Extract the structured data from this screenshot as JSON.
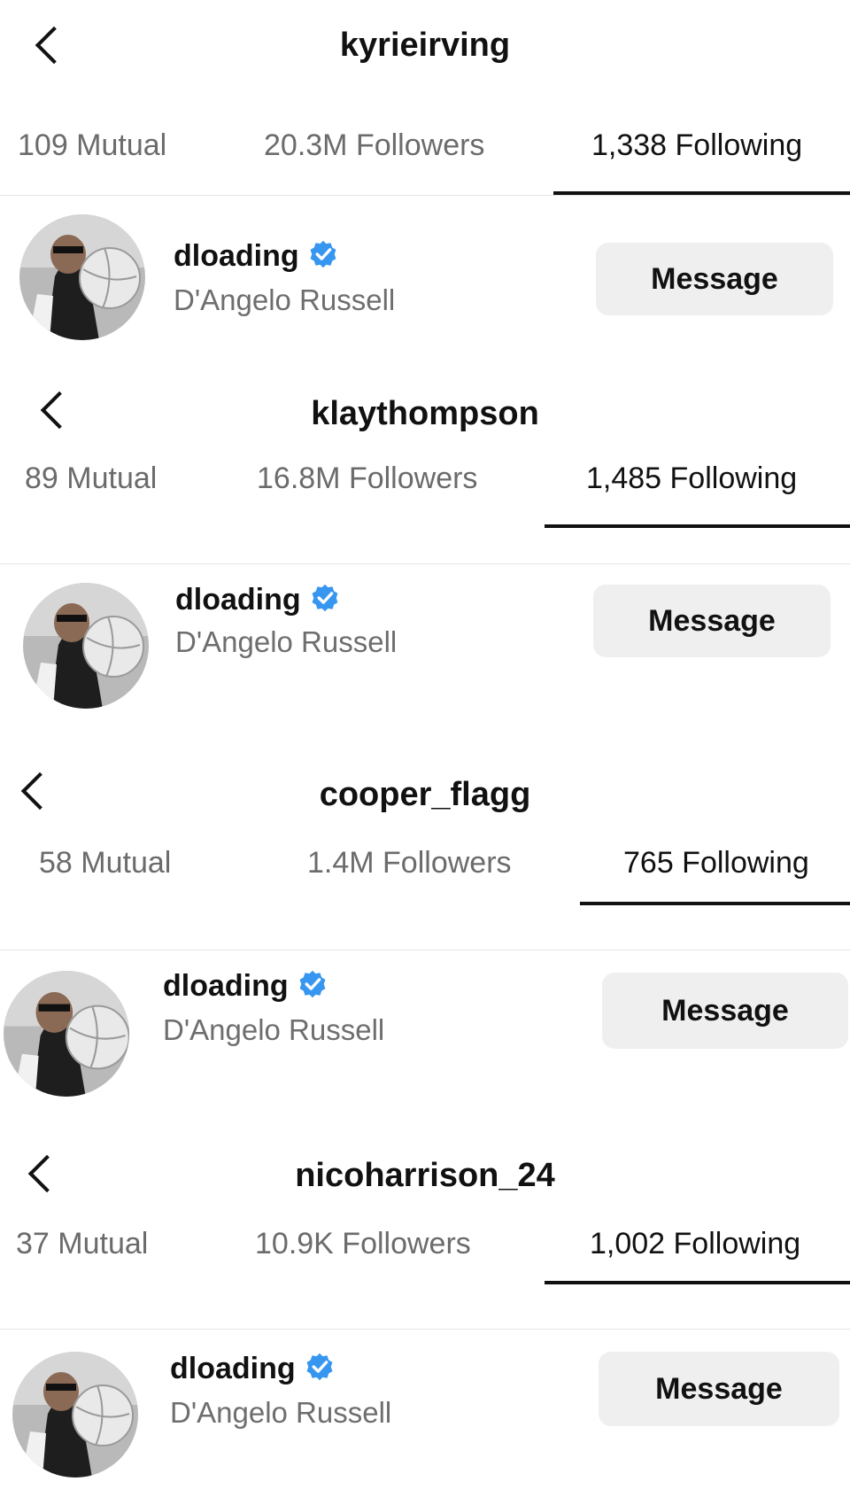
{
  "panels": [
    {
      "profile_username": "kyrieirving",
      "tabs": {
        "mutual": "109 Mutual",
        "followers": "20.3M Followers",
        "following": "1,338 Following"
      },
      "active_tab": "following",
      "result": {
        "username": "dloading",
        "full_name": "D'Angelo Russell",
        "verified": true,
        "button_label": "Message"
      }
    },
    {
      "profile_username": "klaythompson",
      "tabs": {
        "mutual": "89 Mutual",
        "followers": "16.8M Followers",
        "following": "1,485 Following"
      },
      "active_tab": "following",
      "result": {
        "username": "dloading",
        "full_name": "D'Angelo Russell",
        "verified": true,
        "button_label": "Message"
      }
    },
    {
      "profile_username": "cooper_flagg",
      "tabs": {
        "mutual": "58 Mutual",
        "followers": "1.4M Followers",
        "following": "765 Following"
      },
      "active_tab": "following",
      "result": {
        "username": "dloading",
        "full_name": "D'Angelo Russell",
        "verified": true,
        "button_label": "Message"
      }
    },
    {
      "profile_username": "nicoharrison_24",
      "tabs": {
        "mutual": "37 Mutual",
        "followers": "10.9K Followers",
        "following": "1,002 Following"
      },
      "active_tab": "following",
      "result": {
        "username": "dloading",
        "full_name": "D'Angelo Russell",
        "verified": true,
        "button_label": "Message"
      }
    }
  ],
  "icons": {
    "back": "chevron-left-icon",
    "verified": "verified-badge-icon"
  },
  "colors": {
    "verified_blue": "#3797f0",
    "tab_inactive": "#6b6b6b",
    "button_bg": "#efefef"
  }
}
